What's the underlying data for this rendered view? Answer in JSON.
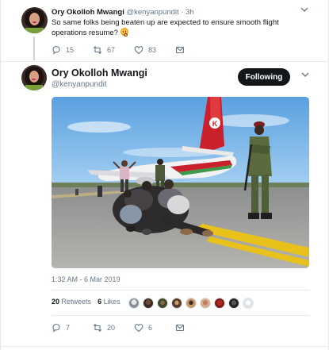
{
  "parent_tweet": {
    "name": "Ory Okolloh Mwangi",
    "handle_time": "@kenyanpundit · 3h",
    "text": "So same folks being beaten up are expected to ensure smooth flight operations resume?",
    "actions": {
      "replies": "15",
      "retweets": "67",
      "likes": "83"
    }
  },
  "main_tweet": {
    "name": "Ory Okolloh Mwangi",
    "handle": "@kenyanpundit",
    "follow_label": "Following",
    "timestamp": "1:32 AM - 6 Mar 2019",
    "stats": {
      "retweets_count": "20",
      "retweets_label": "Retweets",
      "likes_count": "6",
      "likes_label": "Likes"
    },
    "actions": {
      "replies": "7",
      "retweets": "20",
      "likes": "6"
    }
  },
  "icons": {
    "reply": "reply-icon",
    "retweet": "retweet-icon",
    "like": "heart-icon",
    "dm": "envelope-icon",
    "caret": "chevron-down-icon"
  },
  "colors": {
    "accent": "#1da1f2",
    "text_primary": "#14171a",
    "text_secondary": "#657786",
    "follow_button": "#14171a"
  }
}
